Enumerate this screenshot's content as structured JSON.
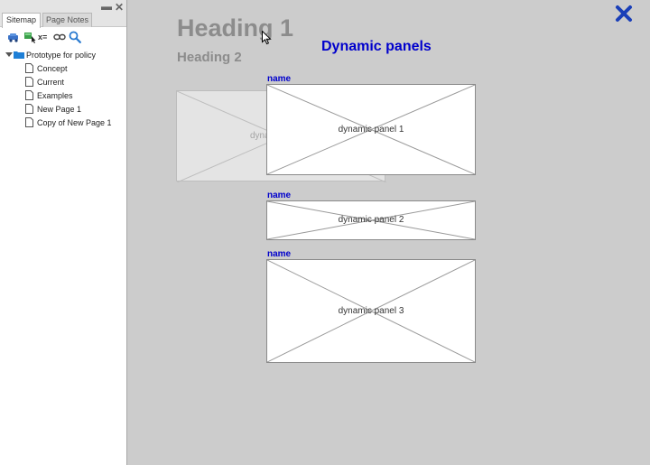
{
  "sidebar": {
    "tabs": [
      "Sitemap",
      "Page Notes"
    ],
    "window_buttons": {
      "minimize": "▬",
      "close": "✕"
    },
    "toolbar_icons": [
      "add-page-icon",
      "add-child-icon",
      "variables-icon",
      "link-icon",
      "search-icon"
    ],
    "toolbar_variable_label": "x=",
    "tree": {
      "root": "Prototype for policy",
      "children": [
        "Concept",
        "Current",
        "Examples",
        "New Page 1",
        "Copy of New Page 1"
      ]
    }
  },
  "canvas": {
    "heading1": "Heading 1",
    "heading2": "Heading 2",
    "panels_title": "Dynamic panels",
    "ghost_label": "dyna",
    "panels": [
      {
        "name": "name",
        "label": "dynamic panel 1"
      },
      {
        "name": "name",
        "label": "dynamic panel 2"
      },
      {
        "name": "name",
        "label": "dynamic panel 3"
      }
    ],
    "accent_color": "#0000cc",
    "close_color": "#1a3fb8"
  }
}
